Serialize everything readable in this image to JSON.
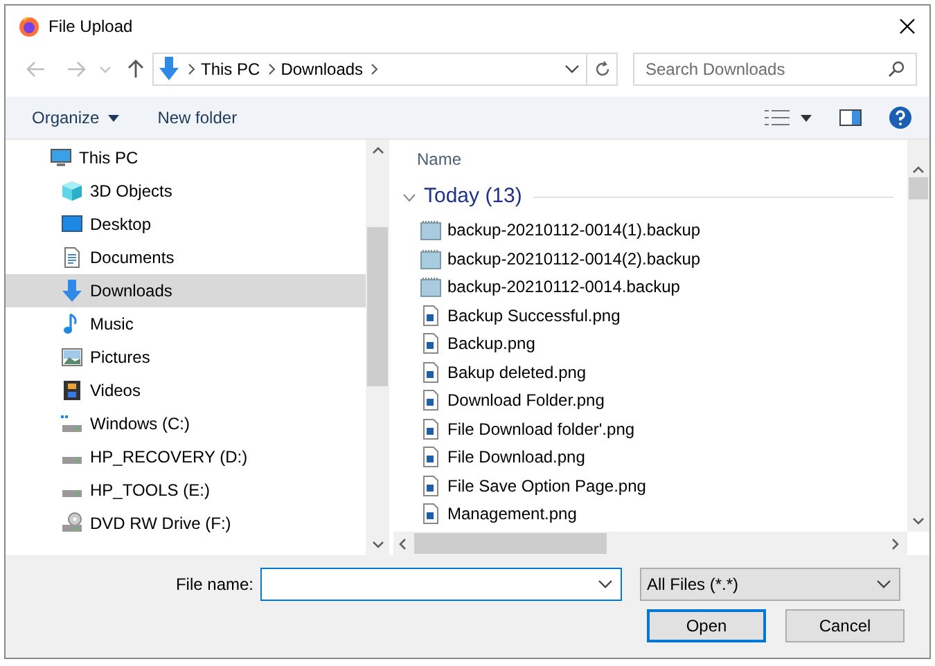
{
  "window": {
    "title": "File Upload"
  },
  "address": {
    "path": [
      "This PC",
      "Downloads"
    ]
  },
  "search": {
    "placeholder": "Search Downloads"
  },
  "toolbar": {
    "organize": "Organize",
    "new_folder": "New folder"
  },
  "nav": {
    "items": [
      {
        "label": "This PC",
        "kind": "pc",
        "selected": false,
        "children": [
          {
            "label": "3D Objects",
            "kind": "cube",
            "selected": false
          },
          {
            "label": "Desktop",
            "kind": "desktop",
            "selected": false
          },
          {
            "label": "Documents",
            "kind": "documents",
            "selected": false
          },
          {
            "label": "Downloads",
            "kind": "downloads",
            "selected": true
          },
          {
            "label": "Music",
            "kind": "music",
            "selected": false
          },
          {
            "label": "Pictures",
            "kind": "pictures",
            "selected": false
          },
          {
            "label": "Videos",
            "kind": "videos",
            "selected": false
          },
          {
            "label": "Windows (C:)",
            "kind": "system_drive",
            "selected": false
          },
          {
            "label": "HP_RECOVERY (D:)",
            "kind": "drive",
            "selected": false
          },
          {
            "label": "HP_TOOLS (E:)",
            "kind": "drive",
            "selected": false
          },
          {
            "label": "DVD RW Drive (F:)",
            "kind": "dvd",
            "selected": false
          }
        ]
      }
    ]
  },
  "files": {
    "column": "Name",
    "group": "Today (13)",
    "items": [
      {
        "name": "backup-20210112-0014(1).backup",
        "kind": "backup"
      },
      {
        "name": "backup-20210112-0014(2).backup",
        "kind": "backup"
      },
      {
        "name": "backup-20210112-0014.backup",
        "kind": "backup"
      },
      {
        "name": "Backup Successful.png",
        "kind": "image"
      },
      {
        "name": "Backup.png",
        "kind": "image"
      },
      {
        "name": "Bakup deleted.png",
        "kind": "image"
      },
      {
        "name": "Download Folder.png",
        "kind": "image"
      },
      {
        "name": "File Download folder'.png",
        "kind": "image"
      },
      {
        "name": "File Download.png",
        "kind": "image"
      },
      {
        "name": "File Save Option Page.png",
        "kind": "image"
      },
      {
        "name": "Management.png",
        "kind": "image"
      }
    ]
  },
  "bottom": {
    "file_name_label": "File name:",
    "file_type": "All Files (*.*)",
    "buttons": [
      {
        "label": "Open",
        "default": true
      },
      {
        "label": "Cancel",
        "default": false
      }
    ]
  }
}
